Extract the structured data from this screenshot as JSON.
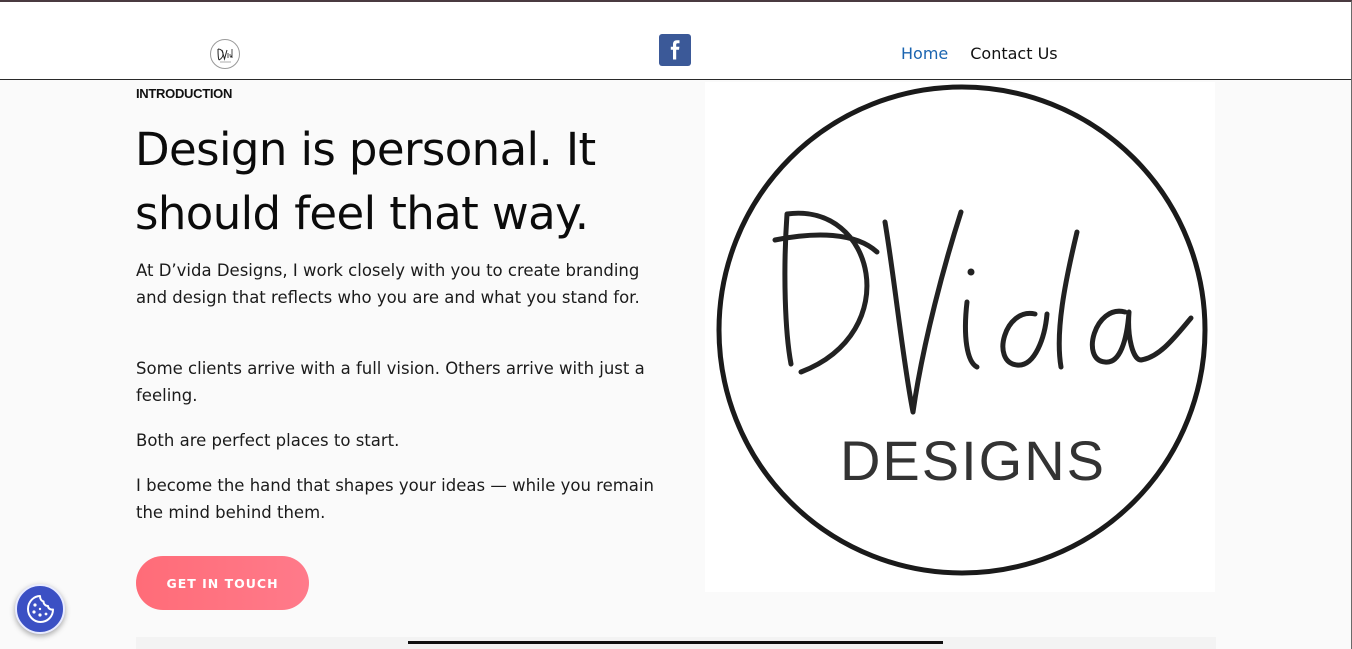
{
  "header": {
    "logo_alt": "D'vida Designs",
    "nav": [
      {
        "label": "Home",
        "active": true
      },
      {
        "label": "Contact Us",
        "active": false
      }
    ],
    "social": {
      "icon": "facebook-icon",
      "glyph": "f",
      "color": "#3b5998"
    }
  },
  "main": {
    "section_label": "INTRODUCTION",
    "headline_line1": "Design is personal. It",
    "headline_line2": "should feel that way.",
    "paragraphs": [
      "At D’vida Designs, I work closely with you to create branding and design that reflects who you are and what you stand for.",
      "Some clients arrive with a full vision. Others arrive with just a feeling.",
      "Both are perfect places to start.",
      "I become the hand that shapes your ideas — while you remain the mind behind them."
    ],
    "cta_label": "GET IN TOUCH"
  },
  "brand_logo": {
    "script_text": "DVida",
    "subtitle": "DESIGNS"
  },
  "cookie": {
    "icon": "cookie-icon"
  },
  "colors": {
    "accent_link": "#1a64b0",
    "cta": "#ff6c78",
    "facebook": "#3b5998",
    "cookie_button": "#3b50c4"
  }
}
